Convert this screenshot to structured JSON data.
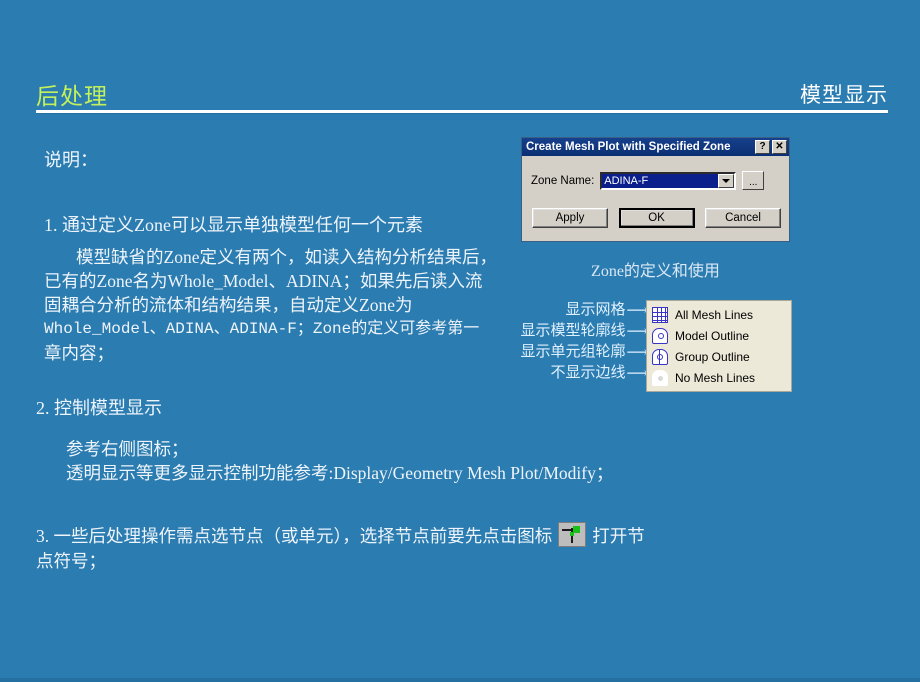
{
  "slide": {
    "header": {
      "title_left": "后处理",
      "title_right": "模型显示",
      "title_left_color": "#c3f05c",
      "title_right_color": "#ffffff"
    },
    "background_color": "#2b7cb0",
    "body": {
      "lead": "说明：",
      "item1_title": "1. 通过定义Zone可以显示单独模型任何一个元素",
      "item1_paragraph_lines": [
        "模型缺省的Zone定义有两个，如读入结构分析结果后，",
        "已有的Zone名为Whole_Model、ADINA；如果先后读入流",
        "固耦合分析的流体和结构结果，自动定义Zone为",
        "Whole_Model、ADINA、ADINA-F；Zone的定义可参考第一",
        "章内容；"
      ],
      "item2_title": "2. 控制模型显示",
      "item2_sub1": "参考右侧图标；",
      "item2_sub2": "透明显示等更多显示控制功能参考:Display/Geometry Mesh Plot/Modify；",
      "item3_line1_prefix": "3. 一些后处理操作需点选节点（或单元），选择节点前要先点击图标",
      "item3_line1_suffix": "打开节",
      "item3_line2": "点符号；",
      "item3_inline_icon": "node-symbol-icon"
    }
  },
  "dialog": {
    "title": "Create Mesh Plot with Specified Zone",
    "help_button": "?",
    "close_button": "✕",
    "field_label": "Zone Name:",
    "field_value": "ADINA-F",
    "field_value_selected": true,
    "dropdown_icon": "chevron-down-icon",
    "browse_button": "...",
    "buttons": {
      "apply": "Apply",
      "ok": "OK",
      "cancel": "Cancel",
      "default": "OK"
    },
    "titlebar_color": "#0b2f73",
    "face_color": "#d4d0c8",
    "selection_color": "#0a1f8c",
    "caption": "Zone的定义和使用"
  },
  "mesh_menu": {
    "background_color": "#ece9d8",
    "icon_color": "#3a34c6",
    "items": [
      {
        "label": "All Mesh Lines",
        "icon": "grid-icon",
        "annotation": "显示网格"
      },
      {
        "label": "Model Outline",
        "icon": "model-outline-icon",
        "annotation": "显示模型轮廓线"
      },
      {
        "label": "Group Outline",
        "icon": "group-outline-icon",
        "annotation": "显示单元组轮廓"
      },
      {
        "label": "No Mesh Lines",
        "icon": "no-mesh-icon",
        "annotation": "不显示边线"
      }
    ],
    "annotation_arrow": "⟶"
  }
}
